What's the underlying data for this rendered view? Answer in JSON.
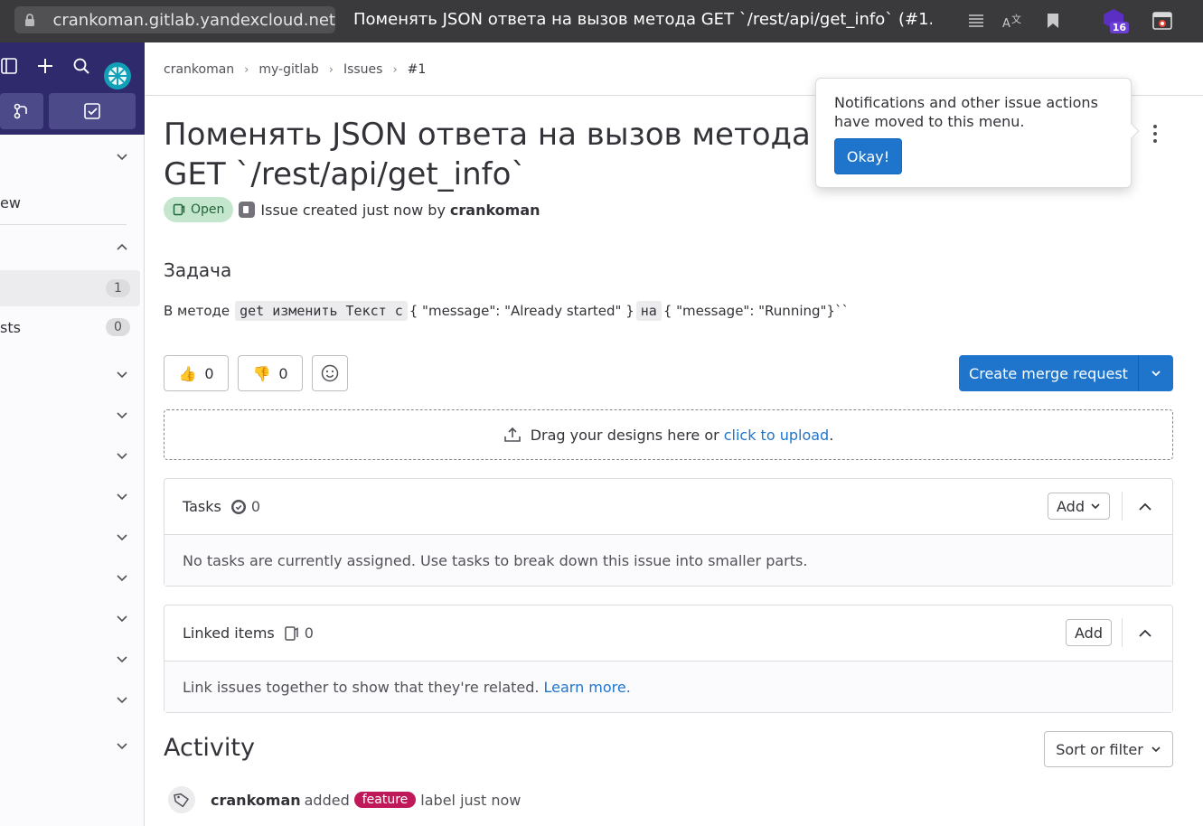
{
  "browser": {
    "url": "crankoman.gitlab.yandexcloud.net",
    "tab_title": "Поменять JSON ответа на вызов метода GET `/rest/api/get_info` (#1...",
    "extension_badge": "16"
  },
  "sidebar": {
    "rows": [
      {
        "label": ""
      },
      {
        "label": "ew"
      },
      {
        "label": ""
      },
      {
        "label": "",
        "count": "1"
      },
      {
        "label": "sts",
        "count": "0"
      }
    ]
  },
  "breadcrumb": {
    "items": [
      "crankoman",
      "my-gitlab",
      "Issues",
      "#1"
    ]
  },
  "issue": {
    "title": "Поменять JSON ответа на вызов метода GET `/rest/api/get_info`",
    "status": "Open",
    "meta_text": "Issue created just now by",
    "author": "crankoman"
  },
  "description": {
    "heading": "Задача",
    "text_before": "В методе",
    "code1": "get изменить Текст с ",
    "text_mid": "{ \"message\": \"Already started\" }",
    "code2": "на",
    "text_after": "{ \"message\": \"Running\"}``"
  },
  "reactions": {
    "thumbsup": "0",
    "thumbsdown": "0"
  },
  "actions": {
    "create_merge_request": "Create merge request"
  },
  "upload": {
    "text": "Drag your designs here or",
    "link": "click to upload",
    "suffix": "."
  },
  "tasks": {
    "title": "Tasks",
    "count": "0",
    "add_label": "Add",
    "empty_text": "No tasks are currently assigned. Use tasks to break down this issue into smaller parts."
  },
  "linked": {
    "title": "Linked items",
    "count": "0",
    "add_label": "Add",
    "empty_text": "Link issues together to show that they're related.",
    "learn_more": "Learn more."
  },
  "activity": {
    "heading": "Activity",
    "sort_label": "Sort or filter",
    "entry": {
      "user": "crankoman",
      "action": "added",
      "label": "feature",
      "suffix": "label just now"
    }
  },
  "popover": {
    "text": "Notifications and other issue actions have moved to this menu.",
    "button": "Okay!"
  },
  "colors": {
    "primary": "#1f75cb",
    "sidebar_top": "#2f2a6b",
    "open_badge_bg": "#c3e6cd",
    "label_feature": "#c0195a"
  }
}
